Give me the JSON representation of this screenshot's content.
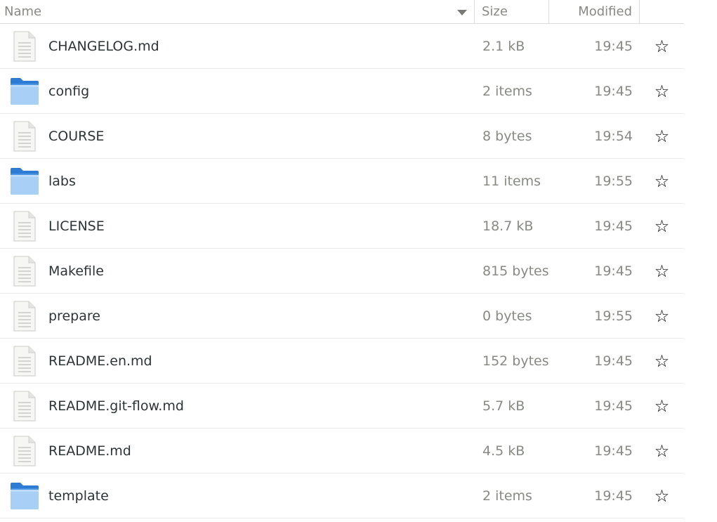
{
  "columns": {
    "name": "Name",
    "size": "Size",
    "modified": "Modified"
  },
  "files": [
    {
      "name": "CHANGELOG.md",
      "size": "2.1 kB",
      "modified": "19:45",
      "icon": "text-file-icon"
    },
    {
      "name": "config",
      "size": "2 items",
      "modified": "19:45",
      "icon": "folder-icon"
    },
    {
      "name": "COURSE",
      "size": "8 bytes",
      "modified": "19:54",
      "icon": "text-file-icon"
    },
    {
      "name": "labs",
      "size": "11 items",
      "modified": "19:55",
      "icon": "folder-icon"
    },
    {
      "name": "LICENSE",
      "size": "18.7 kB",
      "modified": "19:45",
      "icon": "text-file-icon"
    },
    {
      "name": "Makefile",
      "size": "815 bytes",
      "modified": "19:45",
      "icon": "text-file-icon"
    },
    {
      "name": "prepare",
      "size": "0 bytes",
      "modified": "19:55",
      "icon": "text-file-icon"
    },
    {
      "name": "README.en.md",
      "size": "152 bytes",
      "modified": "19:45",
      "icon": "text-file-icon"
    },
    {
      "name": "README.git-flow.md",
      "size": "5.7 kB",
      "modified": "19:45",
      "icon": "text-file-icon"
    },
    {
      "name": "README.md",
      "size": "4.5 kB",
      "modified": "19:45",
      "icon": "text-file-icon"
    },
    {
      "name": "template",
      "size": "2 items",
      "modified": "19:45",
      "icon": "folder-icon"
    }
  ],
  "star_icon": "star-outline-icon",
  "sort_icon": "sort-descending-icon",
  "colors": {
    "folder": "#3d8fe0",
    "text": "#2e3436",
    "muted": "#888a85"
  }
}
